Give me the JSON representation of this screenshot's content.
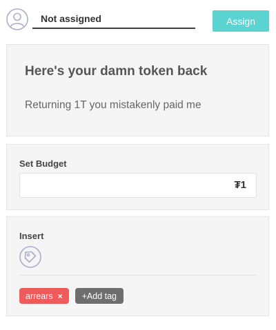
{
  "header": {
    "assignee": "Not assigned",
    "assign_label": "Assign"
  },
  "task": {
    "title": "Here's your damn token back",
    "description": "Returning 1T you mistakenly paid me"
  },
  "budget": {
    "label": "Set Budget",
    "value": "₮1"
  },
  "insert": {
    "label": "Insert"
  },
  "tags": {
    "items": [
      {
        "label": "arrears",
        "remove": "×"
      }
    ],
    "add_label": "+Add tag"
  },
  "icons": {
    "avatar": "user-avatar-icon",
    "tag": "tag-icon"
  },
  "colors": {
    "accent": "#5bd3d0",
    "tag_arrears": "#ef5a5a",
    "add_tag": "#6e6e6e"
  }
}
